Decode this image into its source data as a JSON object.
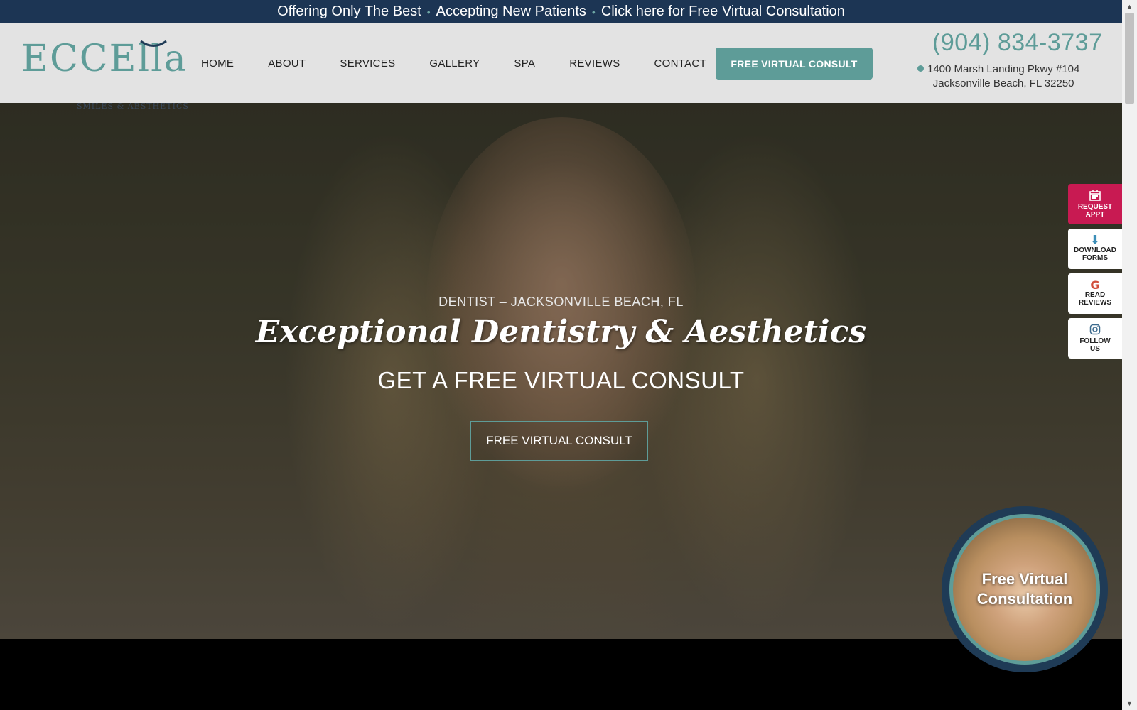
{
  "topbar": {
    "item1": "Offering Only The Best",
    "item2": "Accepting New Patients",
    "item3": "Click here for Free Virtual Consultation",
    "separator": "•"
  },
  "header": {
    "logo_main": "ECCElla",
    "logo_sub": "SMILES & AESTHETICS",
    "nav": [
      "HOME",
      "ABOUT",
      "SERVICES",
      "GALLERY",
      "SPA",
      "REVIEWS",
      "CONTACT"
    ],
    "cta": "FREE VIRTUAL CONSULT",
    "phone": "(904) 834-3737",
    "address_line1": "1400 Marsh Landing Pkwy #104",
    "address_line2": "Jacksonville Beach, FL 32250"
  },
  "hero": {
    "subtitle": "DENTIST – JACKSONVILLE BEACH, FL",
    "title": "Exceptional Dentistry & Aesthetics",
    "tagline": "GET A FREE VIRTUAL CONSULT",
    "button": "FREE VIRTUAL CONSULT"
  },
  "side_tabs": [
    {
      "line1": "REQUEST",
      "line2": "APPT",
      "icon": "calendar-icon"
    },
    {
      "line1": "DOWNLOAD",
      "line2": "FORMS",
      "icon": "download-icon"
    },
    {
      "line1": "READ",
      "line2": "REVIEWS",
      "icon": "google-icon"
    },
    {
      "line1": "FOLLOW",
      "line2": "US",
      "icon": "instagram-icon"
    }
  ],
  "virtual_consult_widget": {
    "text": "Free Virtual Consultation"
  },
  "colors": {
    "brand_teal": "#5e9c98",
    "topbar_navy": "#1c3554",
    "request_pink": "#c81a52"
  }
}
